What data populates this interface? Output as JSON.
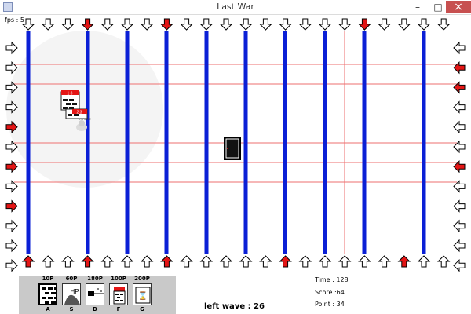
{
  "window": {
    "title": "Last War",
    "minimize_glyph": "–",
    "maximize_glyph": "□",
    "close_glyph": "×"
  },
  "hud": {
    "fps": "fps : 5",
    "left_wave": "left wave : 26",
    "time": "Time : 128",
    "score": "Score :64",
    "point": "Point : 34"
  },
  "board": {
    "lane_columns": 11,
    "row_lanes": 10,
    "top_arrows_state": [
      "white",
      "white",
      "white",
      "red",
      "white",
      "white",
      "white",
      "red",
      "white",
      "white",
      "white",
      "white",
      "white",
      "white",
      "white",
      "white",
      "white",
      "red",
      "white",
      "white",
      "white",
      "white"
    ],
    "bottom_arrows_state": [
      "red",
      "white",
      "white",
      "red",
      "white",
      "white",
      "white",
      "red",
      "white",
      "white",
      "white",
      "white",
      "white",
      "red",
      "white",
      "white",
      "white",
      "white",
      "white",
      "red",
      "white",
      "white"
    ],
    "left_arrows_state": [
      "white",
      "white",
      "white",
      "white",
      "red",
      "white",
      "red",
      "white",
      "red",
      "white",
      "white",
      "white"
    ],
    "right_arrows_state": [
      "white",
      "red",
      "red",
      "white",
      "white",
      "white",
      "red",
      "white",
      "white",
      "white",
      "white",
      "white"
    ],
    "lane_lines": "blue",
    "scan_lines": "red",
    "enemy_tower_1_label": "1 3",
    "enemy_tower_2_label": "2 3",
    "enemy_unit_label": "2 8 3 8 2",
    "door_label": "exit door"
  },
  "toolbar": {
    "items": [
      {
        "cost": "10P",
        "key": "A",
        "icon": "brick-wall-icon",
        "selected": true
      },
      {
        "cost": "60P",
        "key": "S",
        "icon": "hp-heal-icon",
        "selected": false,
        "icon_text": "HP"
      },
      {
        "cost": "180P",
        "key": "D",
        "icon": "laser-icon",
        "selected": false
      },
      {
        "cost": "100P",
        "key": "F",
        "icon": "tower-icon",
        "selected": false
      },
      {
        "cost": "200P",
        "key": "G",
        "icon": "hourglass-icon",
        "selected": false,
        "icon_text": "⌛"
      }
    ]
  },
  "colors": {
    "lane_blue": "#0a1fd6",
    "arrow_red": "#e41515",
    "scan_red": "#ee6f6f",
    "toolbar_gray": "#c9c9c9",
    "close_red": "#c75050"
  }
}
